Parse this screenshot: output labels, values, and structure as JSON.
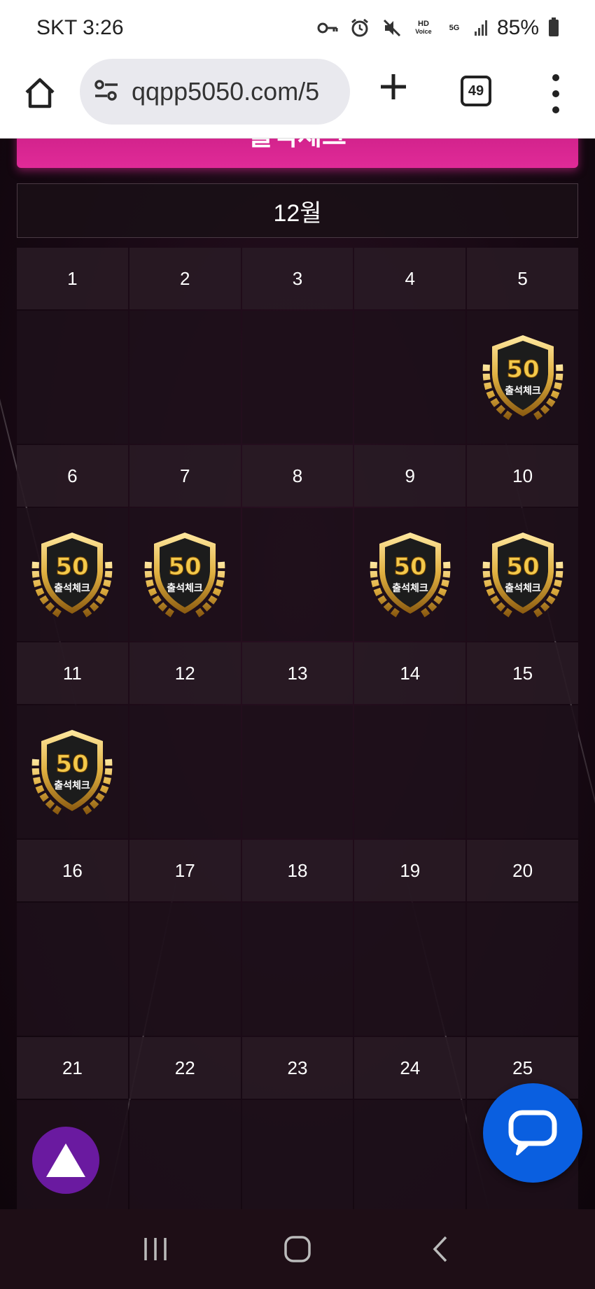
{
  "status_bar": {
    "carrier_time": "SKT 3:26",
    "hd_label": "HD",
    "voice_label": "Voice",
    "network": "5G",
    "battery": "85%"
  },
  "browser": {
    "url": "qqpp5050.com/5",
    "tab_count": "49"
  },
  "page": {
    "header_title": "출석체크",
    "month": "12월",
    "stamp_value": "50",
    "stamp_label": "출석체크",
    "days": [
      {
        "day": "1",
        "stamped": false
      },
      {
        "day": "2",
        "stamped": false
      },
      {
        "day": "3",
        "stamped": false
      },
      {
        "day": "4",
        "stamped": false
      },
      {
        "day": "5",
        "stamped": true
      },
      {
        "day": "6",
        "stamped": true
      },
      {
        "day": "7",
        "stamped": true
      },
      {
        "day": "8",
        "stamped": false
      },
      {
        "day": "9",
        "stamped": true
      },
      {
        "day": "10",
        "stamped": true
      },
      {
        "day": "11",
        "stamped": true
      },
      {
        "day": "12",
        "stamped": false
      },
      {
        "day": "13",
        "stamped": false
      },
      {
        "day": "14",
        "stamped": false
      },
      {
        "day": "15",
        "stamped": false
      },
      {
        "day": "16",
        "stamped": false
      },
      {
        "day": "17",
        "stamped": false
      },
      {
        "day": "18",
        "stamped": false
      },
      {
        "day": "19",
        "stamped": false
      },
      {
        "day": "20",
        "stamped": false
      },
      {
        "day": "21",
        "stamped": false
      },
      {
        "day": "22",
        "stamped": false
      },
      {
        "day": "23",
        "stamped": false
      },
      {
        "day": "24",
        "stamped": false
      },
      {
        "day": "25",
        "stamped": false
      }
    ]
  },
  "colors": {
    "header_pink": "#e02a98",
    "scroll_top_purple": "#6a1aa0",
    "chat_blue": "#0a5fe0",
    "stamp_gold": "#e0b040"
  },
  "icons": {
    "home": "home-icon",
    "site_settings": "tune-icon",
    "new_tab": "plus-icon",
    "menu": "more-vert-icon",
    "scroll_top": "triangle-up-icon",
    "chat": "chat-bubble-icon"
  }
}
